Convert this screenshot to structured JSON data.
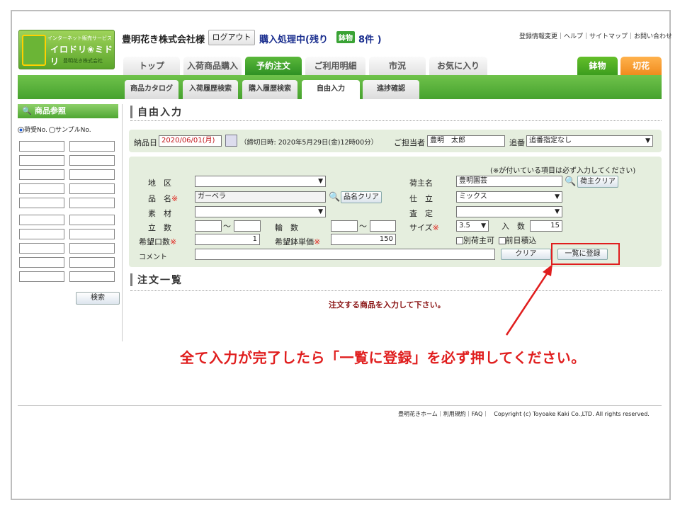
{
  "logo": {
    "line1": "インターネット販売サービス",
    "line2": "イロドリ❀ミドリ",
    "line3": "豊明花き株式会社"
  },
  "header": {
    "company": "豊明花き株式会社様",
    "logout": "ログアウト",
    "status": "購入処理中(残り",
    "badge": "鉢物",
    "count": "8件 )",
    "links": "登録情報変更｜ヘルプ｜サイトマップ｜お問い合わせ"
  },
  "tabs": [
    "トップ",
    "入荷商品購入",
    "予約注文",
    "ご利用明細",
    "市況",
    "お気に入り"
  ],
  "rtabs": [
    "鉢物",
    "切花"
  ],
  "subtabs": [
    "商品カタログ",
    "入荷履歴検索",
    "購入履歴検索",
    "自由入力",
    "進捗確認"
  ],
  "side": {
    "title": "商品参照",
    "radio1": "荷受No.",
    "radio2": "サンプルNo.",
    "search": "検索"
  },
  "main": {
    "title": "自由入力",
    "delivery_label": "納品日",
    "delivery": "2020/06/01(月)",
    "cutoff": "（締切日時: 2020年5月29日(金)12時00分）",
    "staff_label": "ご担当者",
    "staff": "豊明　太郎",
    "oiban_label": "追番",
    "oiban": "追番指定なし",
    "required_note": "(※が付いている項目は必ず入力してください)",
    "area": "地　区",
    "name": "品　名",
    "name_val": "ガーベラ",
    "name_clear": "品名クリア",
    "material": "素　材",
    "tachi": "立　数",
    "rin": "輪　数",
    "tilde": "〜",
    "kibou_kuchi": "希望口数",
    "kibou_kuchi_val": "1",
    "kibou_tanka": "希望鉢単価",
    "kibou_tanka_val": "150",
    "comment": "コメント",
    "shipper": "荷主名",
    "shipper_val": "豊明園芸",
    "shipper_clear": "荷主クリア",
    "shitate": "仕　立",
    "shitate_val": "ミックス",
    "satei": "査　定",
    "size": "サイズ",
    "size_val": "3.5",
    "irisu": "入　数",
    "irisu_val": "15",
    "betsu": "別荷主可",
    "zenjitsu": "前日積込",
    "clear": "クリア",
    "register": "一覧に登録",
    "req_mark": "※"
  },
  "list": {
    "title": "注文一覧",
    "message": "注文する商品を入力して下さい。"
  },
  "annotation": "全て入力が完了したら「一覧に登録」を必ず押してください。",
  "footer": "豊明花きホーム｜利用規約｜FAQ｜　Copyright (c) Toyoake Kaki Co.,LTD. All rights reserved."
}
